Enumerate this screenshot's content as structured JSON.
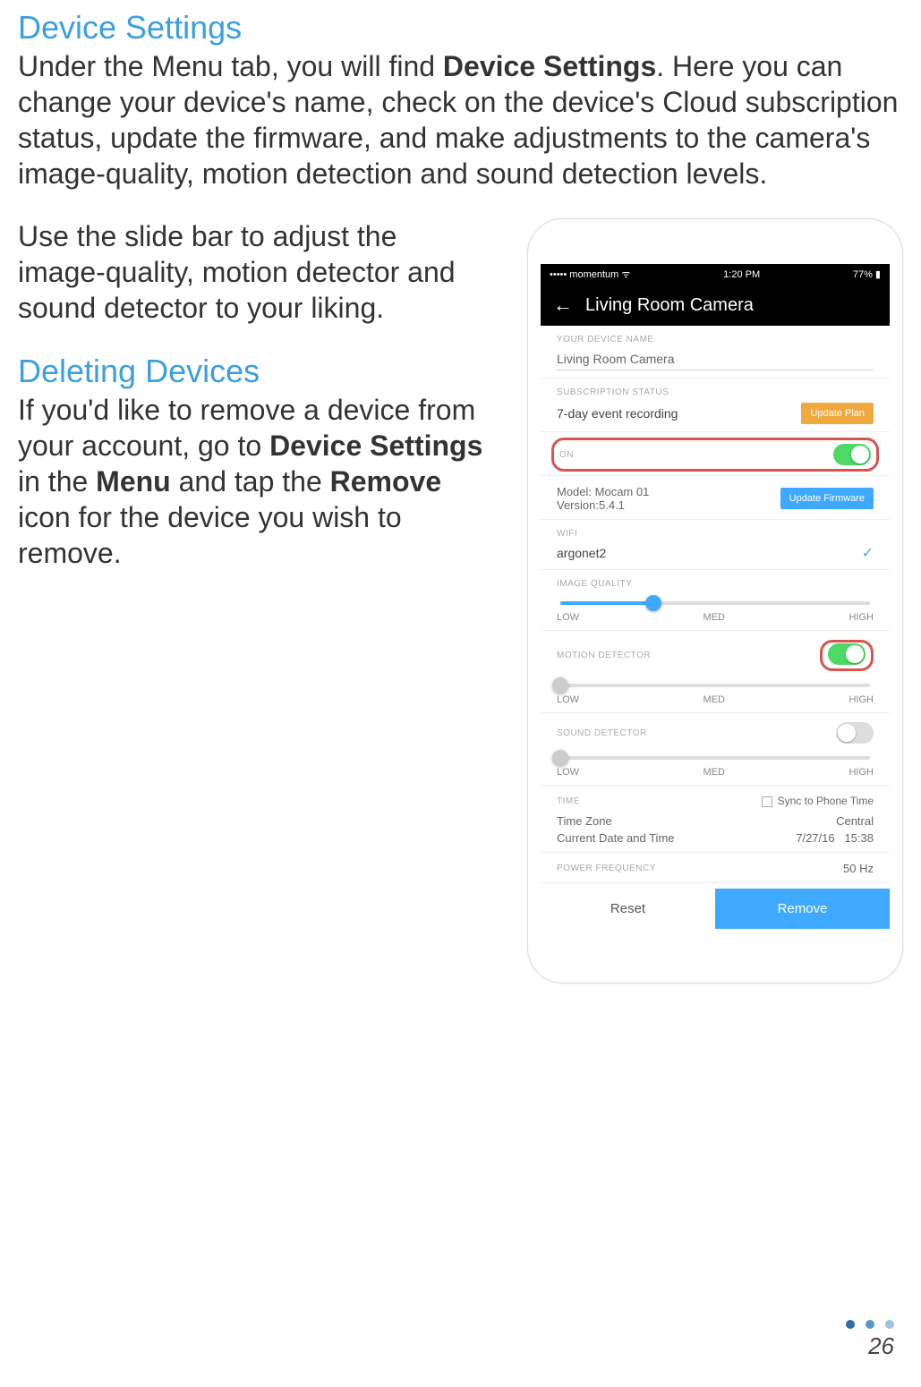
{
  "doc": {
    "h1": "Device Settings",
    "p1_a": "Under the Menu tab, you will find ",
    "p1_bold": "Device Settings",
    "p1_b": ". Here you can change your device's name, check on the device's Cloud subscription status, update the firmware, and make adjustments to the camera's image-quality, motion detection and sound detection levels.",
    "p2": "Use the slide bar to adjust the image-quality, motion detector and sound detector to your liking.",
    "h2": "Deleting Devices",
    "p3_a": "If you'd like to remove a device from your account, go to ",
    "p3_bold1": "Device Settings",
    "p3_b": " in the ",
    "p3_bold2": "Menu",
    "p3_c": " and tap the ",
    "p3_bold3": "Remove",
    "p3_d": " icon for the device you wish to remove.",
    "page_number": "26"
  },
  "phone": {
    "status_left": "••••• momentum  ᯤ",
    "status_time": "1:20 PM",
    "status_right": "77% ▮",
    "header_title": "Living Room Camera",
    "device_name_label": "YOUR DEVICE NAME",
    "device_name_value": "Living Room Camera",
    "subscription_label": "SUBSCRIPTION STATUS",
    "subscription_value": "7-day event recording",
    "update_plan_btn": "Update Plan",
    "on_label": "ON",
    "model_line": "Model: Mocam 01",
    "version_line": "Version:5.4.1",
    "update_fw_btn": "Update Firmware",
    "wifi_label": "WIFI",
    "wifi_value": "argonet2",
    "iq_label": "IMAGE QUALITY",
    "md_label": "MOTION DETECTOR",
    "sd_label": "SOUND DETECTOR",
    "low": "LOW",
    "med": "MED",
    "high": "HIGH",
    "time_label": "TIME",
    "sync_label": "Sync to Phone Time",
    "tz_label": "Time Zone",
    "tz_value": "Central",
    "dt_label": "Current Date and Time",
    "dt_date": "7/27/16",
    "dt_time": "15:38",
    "pf_label": "POWER FREQUENCY",
    "pf_value": "50 Hz",
    "reset_btn": "Reset",
    "remove_btn": "Remove"
  }
}
